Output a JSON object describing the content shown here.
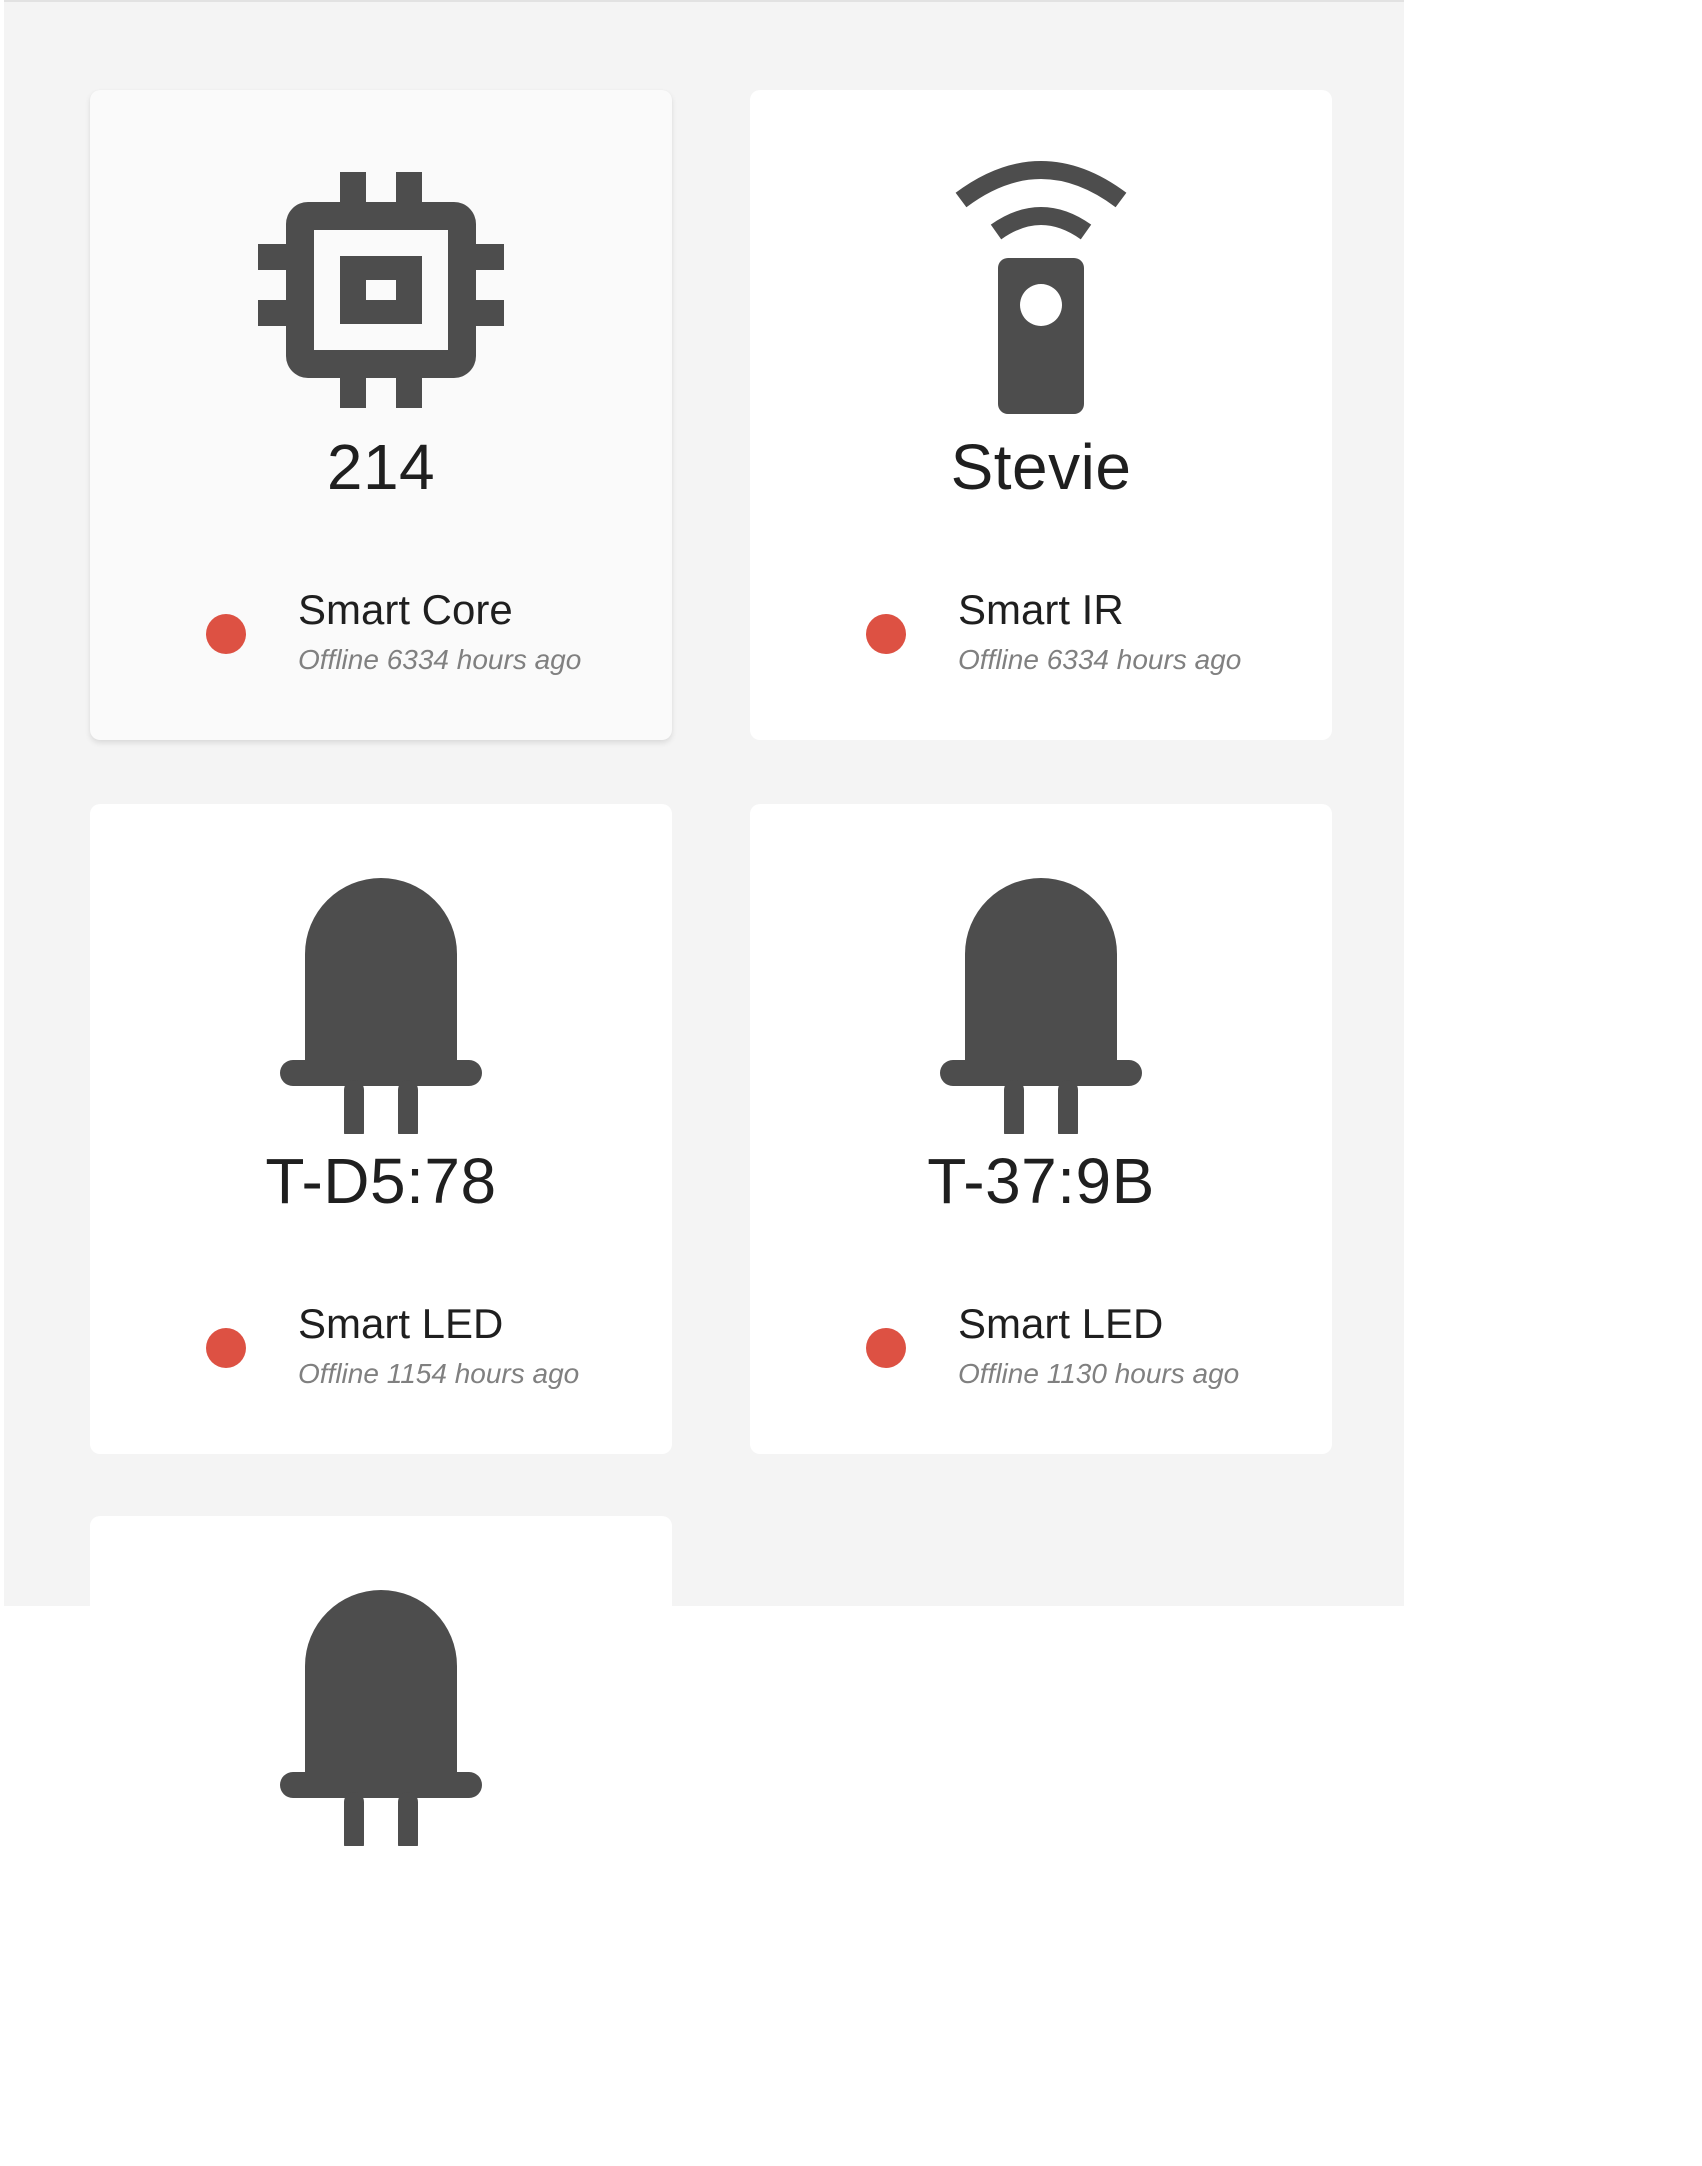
{
  "devices": [
    {
      "name": "214",
      "type": "Smart Core",
      "status": "Offline 6334 hours ago",
      "icon": "chip-icon"
    },
    {
      "name": "Stevie",
      "type": "Smart IR",
      "status": "Offline 6334 hours ago",
      "icon": "ir-remote-icon"
    },
    {
      "name": "T-D5:78",
      "type": "Smart LED",
      "status": "Offline 1154 hours ago",
      "icon": "led-icon"
    },
    {
      "name": "T-37:9B",
      "type": "Smart LED",
      "status": "Offline 1130 hours ago",
      "icon": "led-icon"
    },
    {
      "name": "",
      "type": "",
      "status": "",
      "icon": "led-icon"
    }
  ],
  "colors": {
    "offline": "#dd5143",
    "icon": "#4d4d4d",
    "panel_bg": "#f4f4f4",
    "card_bg": "#ffffff"
  }
}
